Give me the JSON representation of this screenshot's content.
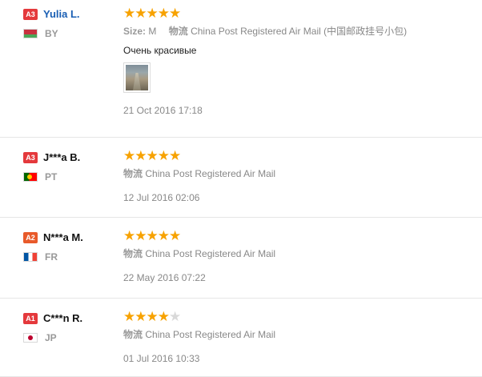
{
  "colors": {
    "star_on": "#f7a200",
    "star_off": "#d9d9d9",
    "link": "#1a5fb4",
    "level_badge": "#e4393c"
  },
  "reviews": [
    {
      "level": "A3",
      "name": "Yulia L.",
      "flag_icon": "belarus-flag-icon",
      "country": "BY",
      "stars": 5,
      "stars_max": 5,
      "size_label": "Size:",
      "size_value": "M",
      "shipping_label": "物流",
      "shipping_value": "China Post Registered Air Mail (中国邮政挂号小包)",
      "feedback": "Очень красивые",
      "photo_icon": "review-photo-thumbnail",
      "date": "21 Oct 2016 17:18"
    },
    {
      "level": "A3",
      "name": "J***a B.",
      "flag_icon": "portugal-flag-icon",
      "country": "PT",
      "stars": 5,
      "stars_max": 5,
      "shipping_label": "物流",
      "shipping_value": "China Post Registered Air Mail",
      "date": "12 Jul 2016 02:06"
    },
    {
      "level": "A2",
      "name": "N***a M.",
      "flag_icon": "france-flag-icon",
      "country": "FR",
      "stars": 5,
      "stars_max": 5,
      "shipping_label": "物流",
      "shipping_value": "China Post Registered Air Mail",
      "date": "22 May 2016 07:22"
    },
    {
      "level": "A1",
      "name": "C***n R.",
      "flag_icon": "japan-flag-icon",
      "country": "JP",
      "stars": 4,
      "stars_max": 5,
      "shipping_label": "物流",
      "shipping_value": "China Post Registered Air Mail",
      "date": "01 Jul 2016 10:33"
    }
  ]
}
